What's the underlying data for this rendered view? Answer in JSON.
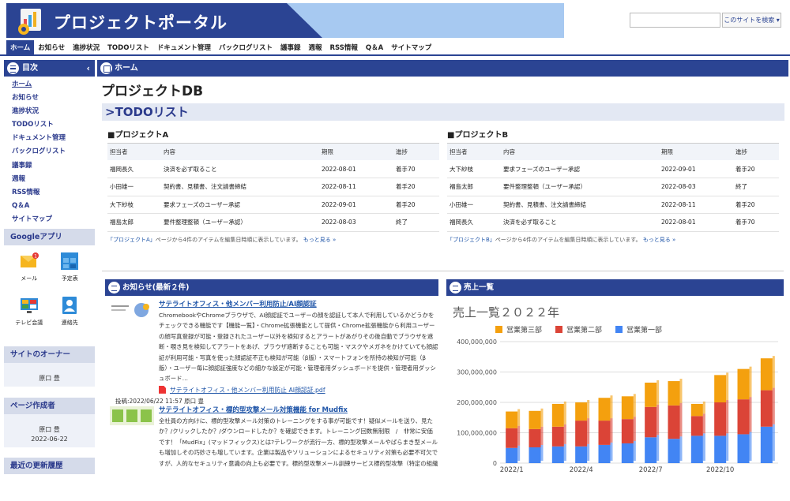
{
  "site": {
    "title": "プロジェクトポータル"
  },
  "search": {
    "placeholder": "",
    "button": "このサイトを検索 ▾"
  },
  "topnav": [
    "ホーム",
    "お知らせ",
    "進捗状況",
    "TODOリスト",
    "ドキュメント管理",
    "バックログリスト",
    "議事録",
    "週報",
    "RSS情報",
    "Q＆A",
    "サイトマップ"
  ],
  "sidebar": {
    "toc_title": "目次",
    "links": [
      "ホーム",
      "お知らせ",
      "進捗状況",
      "TODOリスト",
      "ドキュメント管理",
      "バックログリスト",
      "議事録",
      "週報",
      "RSS情報",
      "Q＆A",
      "サイトマップ"
    ],
    "google_title": "Googleアプリ",
    "apps": [
      {
        "label": "メール",
        "icon": "mail-icon",
        "badge": "1"
      },
      {
        "label": "予定表",
        "icon": "calendar-icon"
      },
      {
        "label": "テレビ会議",
        "icon": "video-meeting-icon"
      },
      {
        "label": "連絡先",
        "icon": "contacts-icon"
      }
    ],
    "owner_title": "サイトのオーナー",
    "owner_name": "原口 豊",
    "creator_title": "ページ作成者",
    "creator_name": "原口 豊",
    "creator_date": "2022-06-22",
    "recent_title": "最近の更新履歴"
  },
  "main": {
    "home_bar": "ホーム",
    "page_title": "プロジェクトDB",
    "todo_heading": ">TODOリスト",
    "columns": [
      "担当者",
      "内容",
      "期限",
      "進捗"
    ],
    "projA": {
      "title": "■プロジェクトA",
      "rows": [
        [
          "福岡長久",
          "決済を必ず取ること",
          "2022-08-01",
          "着手70"
        ],
        [
          "小田雄一",
          "契約書、見積書、注文請書締結",
          "2022-08-11",
          "着手20"
        ],
        [
          "大下紗枝",
          "要求フェーズのユーザー承認",
          "2022-09-01",
          "着手20"
        ],
        [
          "福島太郎",
          "要件整理整頓（ユーザー承認）",
          "2022-08-03",
          "終了"
        ]
      ],
      "note_link": "「プロジェクトA」",
      "note_text": "ページから4件のアイテムを編集日時順に表示しています。",
      "more": "もっと見る »"
    },
    "projB": {
      "title": "■プロジェクトB",
      "rows": [
        [
          "大下紗枝",
          "要求フェーズのユーザー承認",
          "2022-09-01",
          "着手20"
        ],
        [
          "福島太郎",
          "要件整理整頓（ユーザー承認）",
          "2022-08-03",
          "終了"
        ],
        [
          "小田雄一",
          "契約書、見積書、注文請書締結",
          "2022-08-11",
          "着手20"
        ],
        [
          "福岡長久",
          "決済を必ず取ること",
          "2022-08-01",
          "着手70"
        ]
      ],
      "note_link": "「プロジェクトB」",
      "note_text": "ページから4件のアイテムを編集日時順に表示しています。",
      "more": "もっと見る »"
    }
  },
  "news": {
    "header": "お知らせ(最新２件)",
    "items": [
      {
        "title": "サテライトオフィス・他メンバー利用防止/AI顔認証",
        "body": "ChromebookやChromeブラウザで、AI顔認証でユーザーの顔を認証して本人で利用しているかどうかをチェックできる機能です【機能一覧】・Chrome拡張機能として提供・Chrome拡張機能から利用ユーザーの顔写真登録が可能・登録されたユーザー以外を検知するとアラートがあがりその後自動でブラウザを遮断・覗き見を検知してアラートをあげ、ブラウザ遮断することも可能・マスクやメガネをかけていても顔認証が利用可能・写真を使った顔認証不正も検知が可能（β版）・スマートフォンを所持の検知が可能（β版）・ユーザー毎に顔認証強度などの細かな設定が可能・管理者用ダッシュボードを提供・管理者用ダッシュボード…",
        "attachment": "サテライトオフィス・他メンバー利用防止 AI顔認証.pdf",
        "posted": "投稿:2022/06/22 11:57 原口 豊"
      },
      {
        "title": "サテライトオフィス・標的型攻撃メール対策機能 for Mudfix",
        "body": "全社員の方向けに、標的型攻撃メール対策のトレーニングをする事が可能です！疑似メールを送り、見たか？/クリックしたか？/ダウンロードしたか？を確認できます。トレーニング回数無制限　/　非常に安価です！「MudFix」(マッドフィックス)とは?テレワークが流行一方、標的型攻撃メールやばらまき型メールも増加しその巧妙さも増しています。企業は製品やソリューションによるセキュリティ対策も必要不可欠ですが、人的なセキュリティ意識の向上も必要です。標的型攻撃メール訓練サービス標的型攻撃（特定の組織"
      }
    ]
  },
  "sales": {
    "header": "売上一覧"
  },
  "chart_data": {
    "type": "bar",
    "title": "売上一覧２０２２年",
    "categories": [
      "2022/1",
      "2022/2",
      "2022/3",
      "2022/4",
      "2022/5",
      "2022/6",
      "2022/7",
      "2022/8",
      "2022/9",
      "2022/10",
      "2022/11",
      "2022/12"
    ],
    "xlabels_shown": [
      "2022/1",
      "2022/4",
      "2022/7",
      "2022/10"
    ],
    "series": [
      {
        "name": "営業第一部",
        "color": "#4285f4",
        "values": [
          50000000,
          52000000,
          55000000,
          55000000,
          60000000,
          65000000,
          85000000,
          80000000,
          90000000,
          90000000,
          95000000,
          120000000
        ]
      },
      {
        "name": "営業第二部",
        "color": "#db4437",
        "values": [
          65000000,
          60000000,
          65000000,
          85000000,
          80000000,
          80000000,
          100000000,
          110000000,
          65000000,
          110000000,
          115000000,
          120000000
        ]
      },
      {
        "name": "営業第三部",
        "color": "#f4a00e",
        "values": [
          55000000,
          60000000,
          75000000,
          60000000,
          75000000,
          75000000,
          80000000,
          80000000,
          40000000,
          90000000,
          100000000,
          105000000
        ]
      }
    ],
    "legend_order": [
      "営業第三部",
      "営業第二部",
      "営業第一部"
    ],
    "ylim": [
      0,
      400000000
    ],
    "yticks": [
      "0",
      "100,000,000",
      "200,000,000",
      "300,000,000",
      "400,000,000"
    ],
    "stacked": true,
    "grid": true,
    "legend_position": "top"
  }
}
